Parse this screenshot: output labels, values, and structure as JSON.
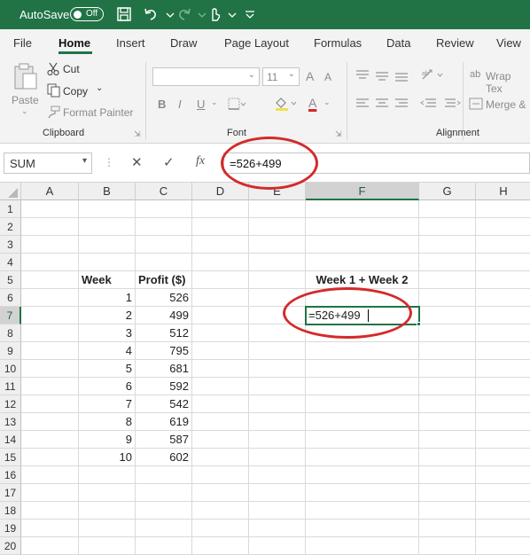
{
  "titlebar": {
    "autosave_label": "AutoSave",
    "autosave_state": "Off",
    "icons": [
      "save-icon",
      "undo-icon",
      "redo-icon",
      "touch-mode-icon",
      "customize-qat-icon"
    ]
  },
  "tabs": [
    "File",
    "Home",
    "Insert",
    "Draw",
    "Page Layout",
    "Formulas",
    "Data",
    "Review",
    "View"
  ],
  "active_tab": "Home",
  "ribbon": {
    "clipboard": {
      "label": "Clipboard",
      "paste": "Paste",
      "cut": "Cut",
      "copy": "Copy",
      "format_painter": "Format Painter"
    },
    "font": {
      "label": "Font",
      "font_name": "",
      "font_size": "11",
      "bold": "B",
      "italic": "I",
      "underline": "U",
      "font_color": "A",
      "grow": "A",
      "shrink": "A"
    },
    "alignment": {
      "label": "Alignment",
      "wrap_text": "Wrap Tex",
      "merge": "Merge &"
    }
  },
  "formula_bar": {
    "name_box": "SUM",
    "fx": "fx",
    "formula": "=526+499"
  },
  "sheet": {
    "columns": [
      "A",
      "B",
      "C",
      "D",
      "E",
      "F",
      "G",
      "H"
    ],
    "rows": [
      "1",
      "2",
      "3",
      "4",
      "5",
      "6",
      "7",
      "8",
      "9",
      "10",
      "11",
      "12",
      "13",
      "14",
      "15",
      "16",
      "17",
      "18",
      "19",
      "20"
    ],
    "selected_column": "F",
    "selected_row": "7",
    "headers": {
      "week": "Week",
      "profit": "Profit ($)",
      "sum": "Week 1 + Week 2"
    },
    "data": [
      {
        "week": "1",
        "profit": "526"
      },
      {
        "week": "2",
        "profit": "499"
      },
      {
        "week": "3",
        "profit": "512"
      },
      {
        "week": "4",
        "profit": "795"
      },
      {
        "week": "5",
        "profit": "681"
      },
      {
        "week": "6",
        "profit": "592"
      },
      {
        "week": "7",
        "profit": "542"
      },
      {
        "week": "8",
        "profit": "619"
      },
      {
        "week": "9",
        "profit": "587"
      },
      {
        "week": "10",
        "profit": "602"
      }
    ],
    "active_cell_value": "=526+499"
  },
  "colors": {
    "accent": "#217346",
    "annotation": "#d42a2a"
  }
}
